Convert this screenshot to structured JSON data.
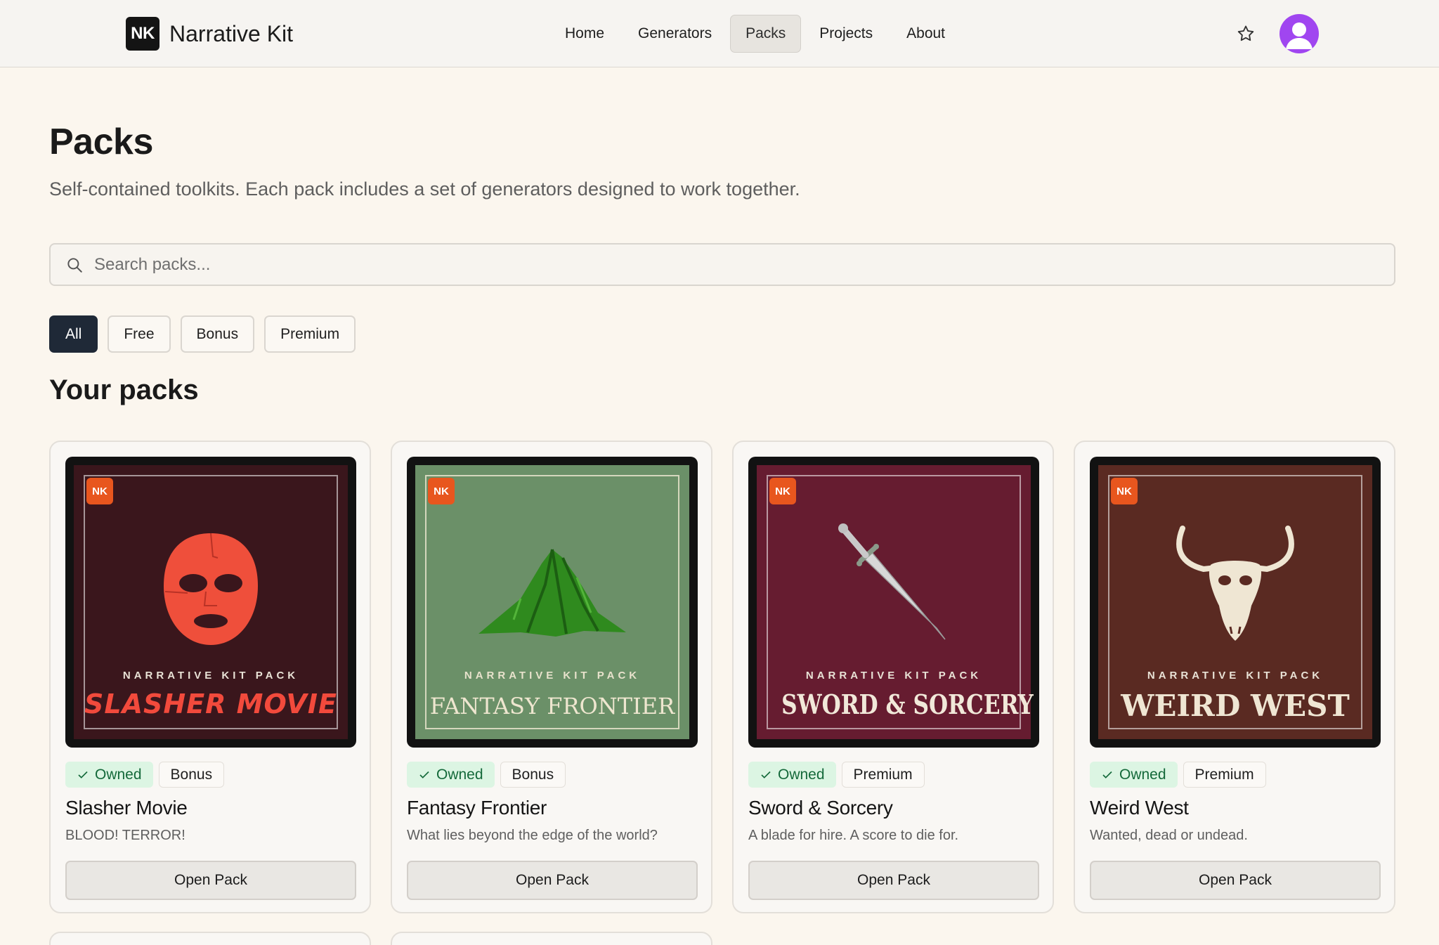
{
  "header": {
    "logo_mark": "NK",
    "logo_text": "Narrative Kit",
    "nav": [
      {
        "label": "Home"
      },
      {
        "label": "Generators"
      },
      {
        "label": "Packs"
      },
      {
        "label": "Projects"
      },
      {
        "label": "About"
      }
    ],
    "active_nav": "Packs",
    "favorites_icon": "star-icon",
    "avatar_icon": "user-avatar-icon"
  },
  "page": {
    "title": "Packs",
    "subtitle": "Self-contained toolkits. Each pack includes a set of generators designed to work together."
  },
  "search": {
    "placeholder": "Search packs...",
    "value": "",
    "icon": "search-icon"
  },
  "filters": [
    {
      "label": "All",
      "active": true
    },
    {
      "label": "Free",
      "active": false
    },
    {
      "label": "Bonus",
      "active": false
    },
    {
      "label": "Premium",
      "active": false
    }
  ],
  "section_title": "Your packs",
  "packs": [
    {
      "cover_badge": "NK",
      "cover_kicker": "NARRATIVE KIT PACK",
      "cover_title": "SLASHER MOVIE",
      "cover_icon": "mask-icon",
      "status": "Owned",
      "tier": "Bonus",
      "name": "Slasher Movie",
      "description": "BLOOD! TERROR!",
      "button": "Open Pack",
      "colors": {
        "bg": "#3a161c",
        "title": "#f24a3c"
      }
    },
    {
      "cover_badge": "NK",
      "cover_kicker": "NARRATIVE KIT PACK",
      "cover_title": "FANTASY FRONTIER",
      "cover_icon": "mountain-icon",
      "status": "Owned",
      "tier": "Bonus",
      "name": "Fantasy Frontier",
      "description": "What lies beyond the edge of the world?",
      "button": "Open Pack",
      "colors": {
        "bg": "#6b9068",
        "title": "#eee6cf"
      }
    },
    {
      "cover_badge": "NK",
      "cover_kicker": "NARRATIVE KIT PACK",
      "cover_title": "SWORD & SORCERY",
      "cover_icon": "sword-icon",
      "status": "Owned",
      "tier": "Premium",
      "name": "Sword & Sorcery",
      "description": "A blade for hire. A score to die for.",
      "button": "Open Pack",
      "colors": {
        "bg": "#661c30",
        "title": "#f1e8d9"
      }
    },
    {
      "cover_badge": "NK",
      "cover_kicker": "NARRATIVE KIT PACK",
      "cover_title": "WEIRD WEST",
      "cover_icon": "bull-skull-icon",
      "status": "Owned",
      "tier": "Premium",
      "name": "Weird West",
      "description": "Wanted, dead or undead.",
      "button": "Open Pack",
      "colors": {
        "bg": "#5a2a22",
        "title": "#efe6d3"
      }
    }
  ]
}
